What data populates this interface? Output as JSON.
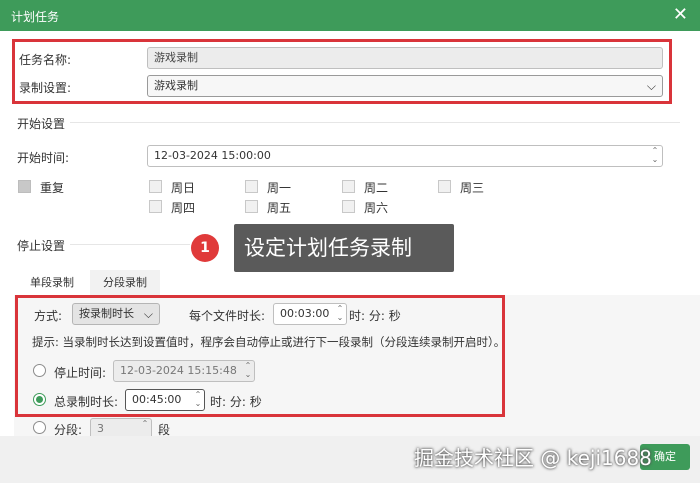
{
  "window": {
    "title": "计划任务",
    "close_glyph": "✕"
  },
  "task": {
    "name_label": "任务名称:",
    "name_value": "游戏录制",
    "record_label": "录制设置:",
    "record_value": "游戏录制"
  },
  "start": {
    "section_label": "开始设置",
    "time_label": "开始时间:",
    "time_value": "12-03-2024 15:00:00",
    "repeat_label": "重复",
    "days": [
      "周日",
      "周一",
      "周二",
      "周三",
      "周四",
      "周五",
      "周六"
    ]
  },
  "stop": {
    "section_label": "停止设置",
    "tabs": [
      "单段录制",
      "分段录制"
    ],
    "active_tab": "分段录制",
    "method_label": "方式:",
    "method_value": "按录制时长",
    "per_file_label": "每个文件时长:",
    "per_file_value": "00:03:00",
    "per_file_unit": "时: 分: 秒",
    "hint": "提示: 当录制时长达到设置值时，程序会自动停止或进行下一段录制（分段连续录制开启时）。",
    "stop_time_label": "停止时间:",
    "stop_time_value": "12-03-2024 15:15:48",
    "total_label": "总录制时长:",
    "total_value": "00:45:00",
    "total_unit": "时: 分: 秒",
    "segment_label": "分段:",
    "segment_value": "3",
    "segment_unit": "段"
  },
  "callout": {
    "badge": "1",
    "text": "设定计划任务录制"
  },
  "footer": {
    "ok_label": "确定",
    "watermark": "掘金技术社区 @ keji1688"
  },
  "colors": {
    "brand": "#3e9b5a",
    "highlight": "#d9343a",
    "callout_bg": "#5a5a5a"
  }
}
